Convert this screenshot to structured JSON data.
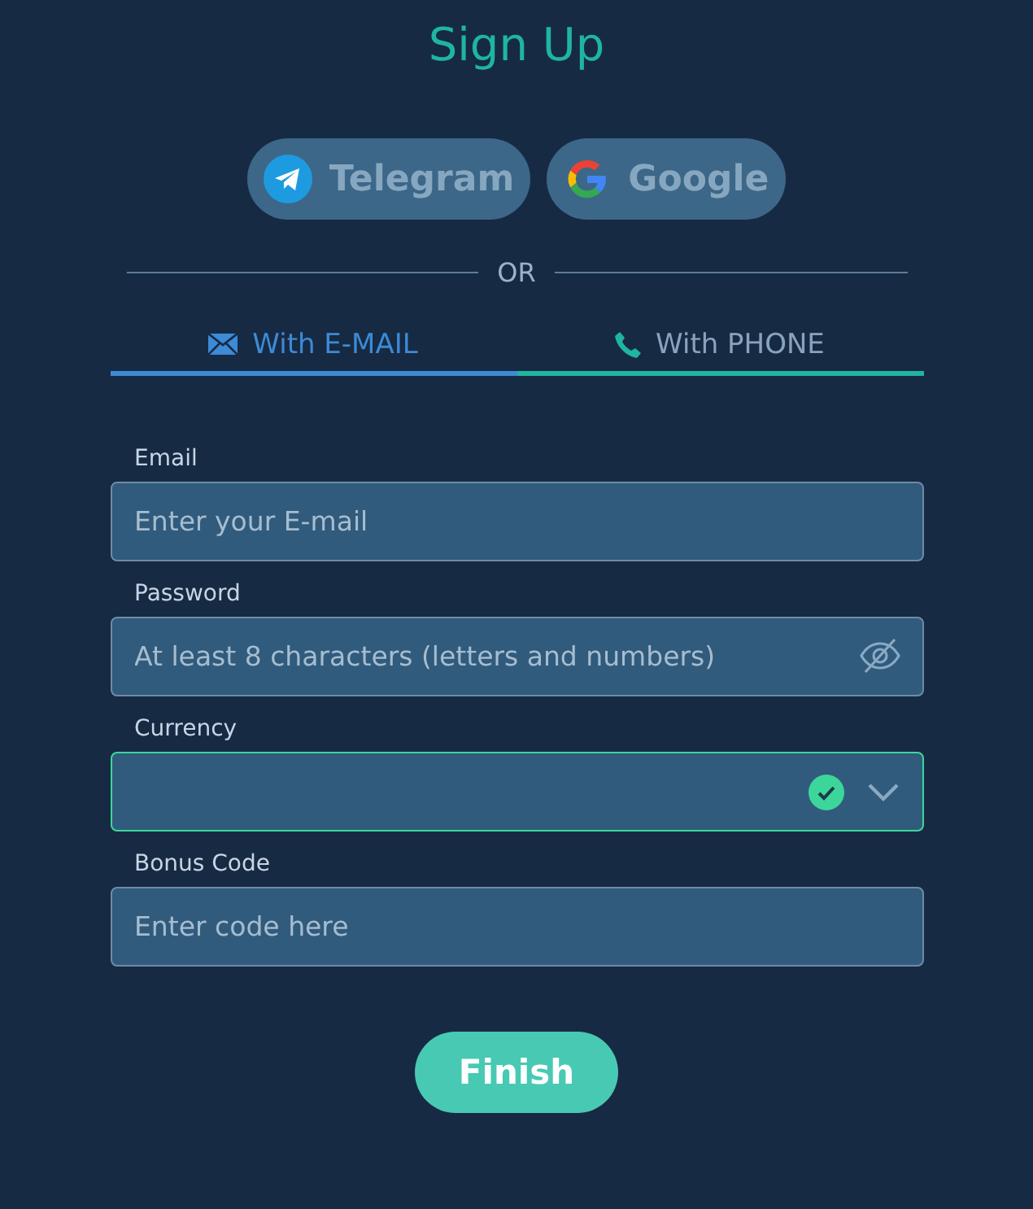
{
  "title": "Sign Up",
  "social_buttons": [
    {
      "kind": "telegram",
      "label": "Telegram"
    },
    {
      "kind": "google",
      "label": "Google"
    }
  ],
  "divider": "OR",
  "tabs": [
    {
      "kind": "email",
      "label": "With E-MAIL",
      "selected": true
    },
    {
      "kind": "phone",
      "label": "With PHONE",
      "selected": false
    }
  ],
  "fields": [
    {
      "kind": "text",
      "label": "Email",
      "placeholder": "Enter your E-mail",
      "valid": false
    },
    {
      "kind": "password",
      "label": "Password",
      "placeholder": "At least 8 characters (letters and numbers)",
      "valid": false
    },
    {
      "kind": "select",
      "label": "Currency",
      "valid": true
    },
    {
      "kind": "text",
      "label": "Bonus Code",
      "placeholder": "Enter code here",
      "valid": false
    }
  ],
  "submit": "Finish"
}
